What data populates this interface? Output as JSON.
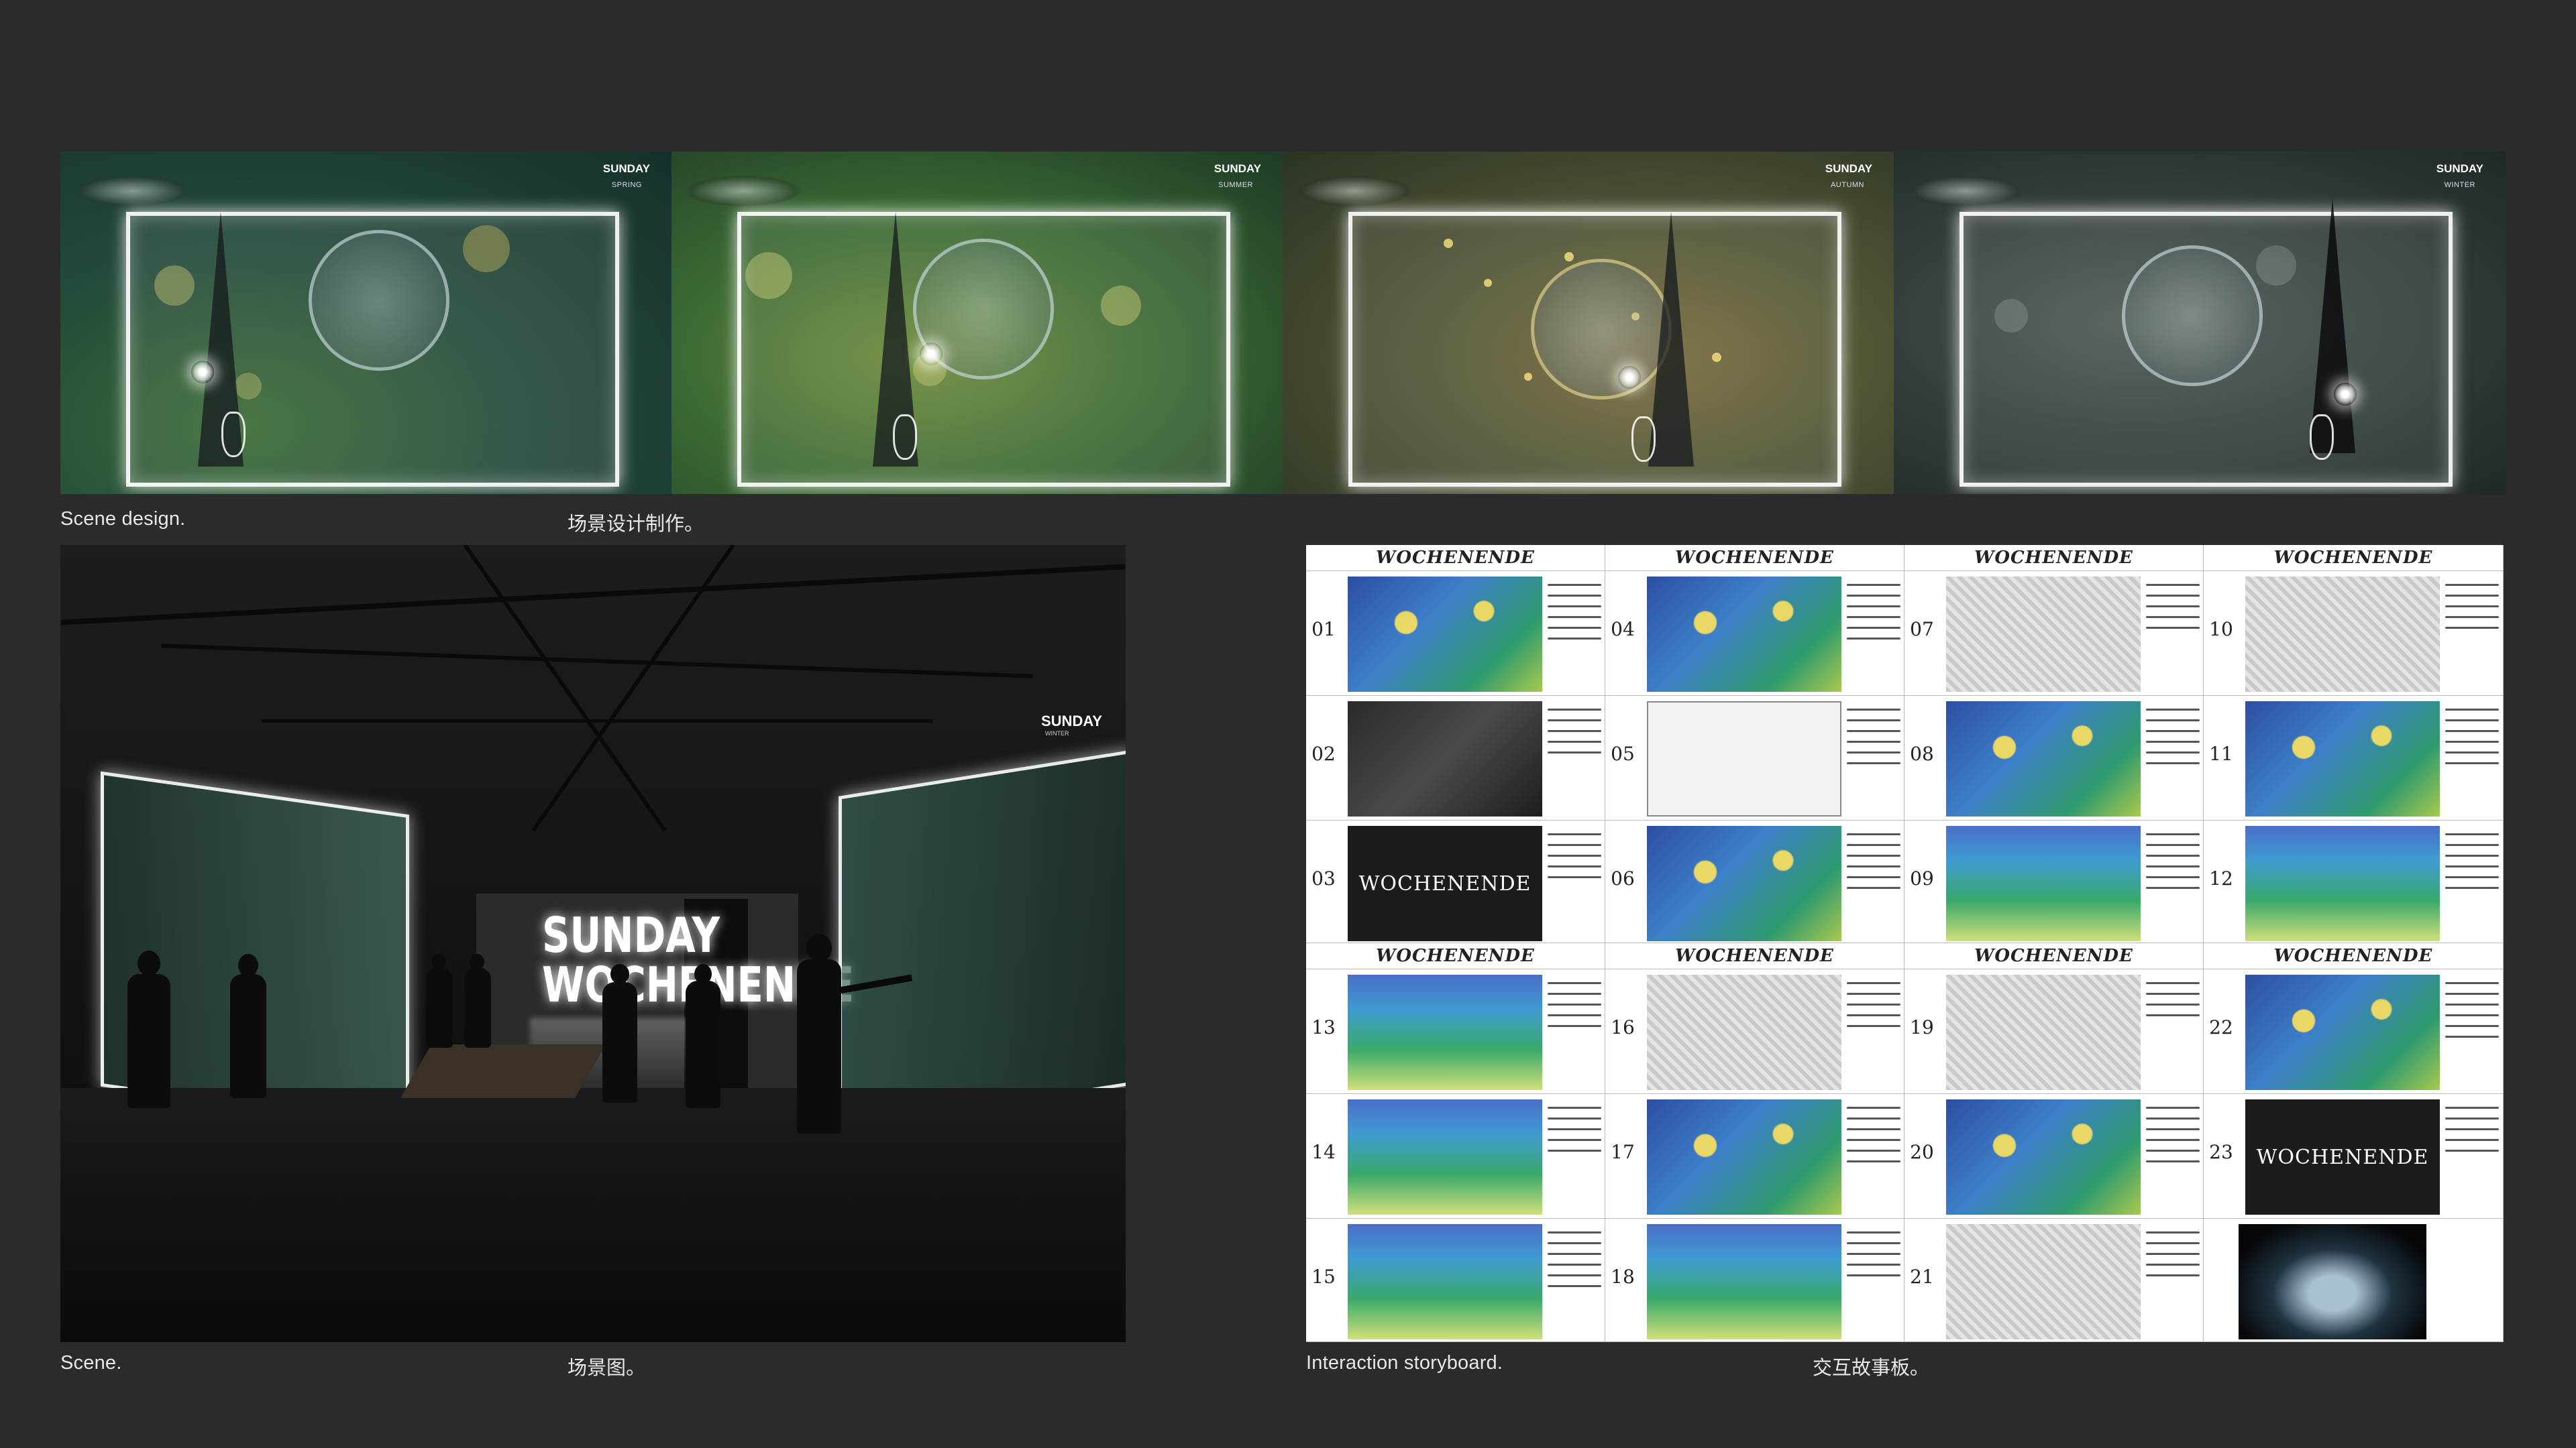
{
  "seasons": [
    {
      "title": "SUNDAY",
      "sub": "SPRING"
    },
    {
      "title": "SUNDAY",
      "sub": "SUMMER"
    },
    {
      "title": "SUNDAY",
      "sub": "AUTUMN"
    },
    {
      "title": "SUNDAY",
      "sub": "WINTER"
    }
  ],
  "captions": {
    "scene_design": "Scene design.",
    "scene_design_cn": "场景设计制作。",
    "scene": "Scene.",
    "scene_cn": "场景图。",
    "storyboard": "Interaction storyboard.",
    "storyboard_cn": "交互故事板。"
  },
  "photo": {
    "sign_line1": "SUNDAY",
    "sign_line2": "WOCHENENDE",
    "wall_title": "SUNDAY",
    "wall_sub": "WINTER"
  },
  "storyboard": {
    "header": "WOCHENENDE",
    "title_card": "WOCHENENDE",
    "numbers": [
      "01",
      "02",
      "03",
      "04",
      "05",
      "06",
      "07",
      "08",
      "09",
      "10",
      "11",
      "12",
      "13",
      "14",
      "15",
      "16",
      "17",
      "18",
      "19",
      "20",
      "21",
      "22",
      "23"
    ]
  },
  "colors": {
    "background": "#2b2b2b",
    "caption": "#e8e8e8",
    "board": "#ffffff"
  }
}
